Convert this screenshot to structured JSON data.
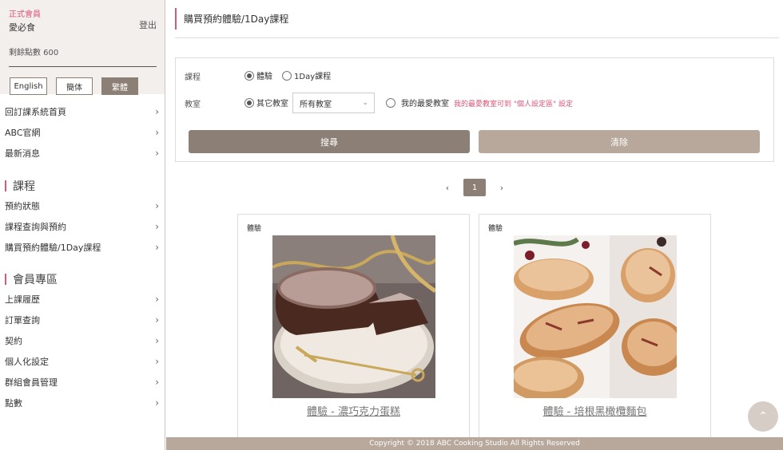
{
  "member": {
    "type": "正式會員",
    "name": "愛必食",
    "logout": "登出",
    "points": "剩餘點數 600"
  },
  "languages": [
    "English",
    "簡体",
    "繁體"
  ],
  "nav": {
    "top": [
      "回訂課系統首頁",
      "ABC官網",
      "最新消息"
    ],
    "course_title": "課程",
    "course": [
      "預約狀態",
      "課程查詢與預約",
      "購買預約體驗/1Day課程"
    ],
    "member_title": "會員專區",
    "member": [
      "上課履歷",
      "訂單查詢",
      "契約",
      "個人化設定",
      "群組會員管理",
      "點數"
    ]
  },
  "page": {
    "title": "購買預約體驗/1Day課程"
  },
  "search": {
    "course_label": "課程",
    "course_opt1": "體驗",
    "course_opt2": "1Day課程",
    "classroom_label": "教室",
    "classroom_opt1": "其它教室",
    "classroom_select": "所有教室",
    "classroom_opt2": "我的最愛教室",
    "hint": "我的最愛教室可到 \"個人設定區\" 設定",
    "search_btn": "搜尋",
    "clear_btn": "清除"
  },
  "pager": {
    "prev": "‹",
    "current": "1",
    "next": "›"
  },
  "cards": [
    {
      "tag": "體驗",
      "title": "體驗 - 濃巧克力蛋糕"
    },
    {
      "tag": "體驗",
      "title": "體驗 - 培根黑橄欖麵包"
    }
  ],
  "footer": "Copyright © 2018 ABC Cooking Studio All Rights Reserved",
  "icons": {
    "chevron": "›",
    "scroll_top": "⌃"
  },
  "colors": {
    "accent": "#d9577a",
    "primary_btn": "#8c7f76",
    "secondary_btn": "#b7a89b"
  }
}
